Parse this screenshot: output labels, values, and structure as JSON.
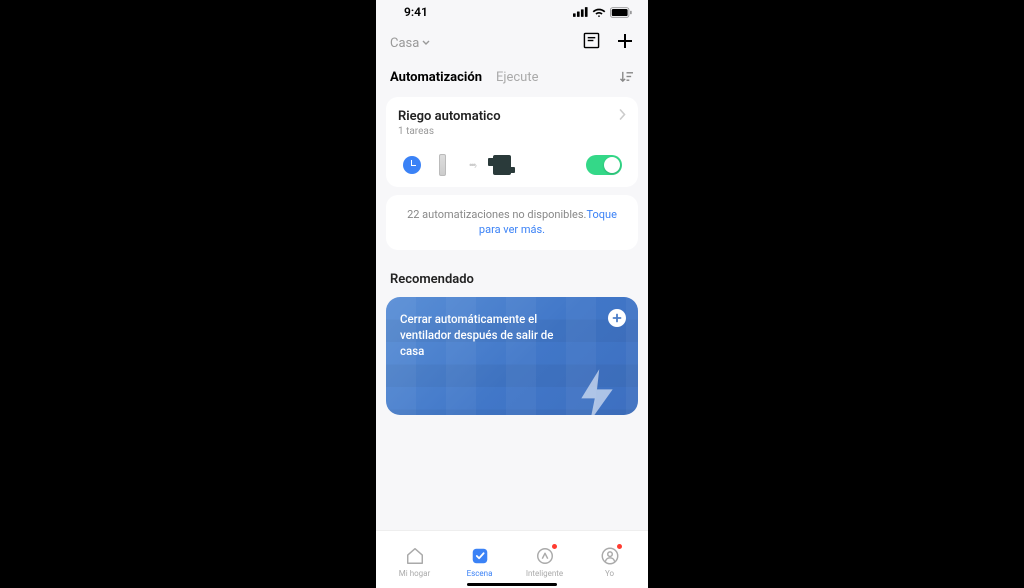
{
  "statusbar": {
    "time": "9:41"
  },
  "topnav": {
    "location": "Casa"
  },
  "tabs": {
    "automatizacion": "Automatización",
    "ejecute": "Ejecute"
  },
  "automation": {
    "title": "Riego automatico",
    "subtitle": "1 tareas"
  },
  "banner": {
    "text": "22 automatizaciones no disponibles.",
    "link": "Toque para ver más."
  },
  "recommended": {
    "section_title": "Recomendado",
    "card_text": "Cerrar automáticamente el ventilador después de salir de casa"
  },
  "tabbar": {
    "home": "Mi hogar",
    "scene": "Escena",
    "smart": "Inteligente",
    "me": "Yo"
  }
}
